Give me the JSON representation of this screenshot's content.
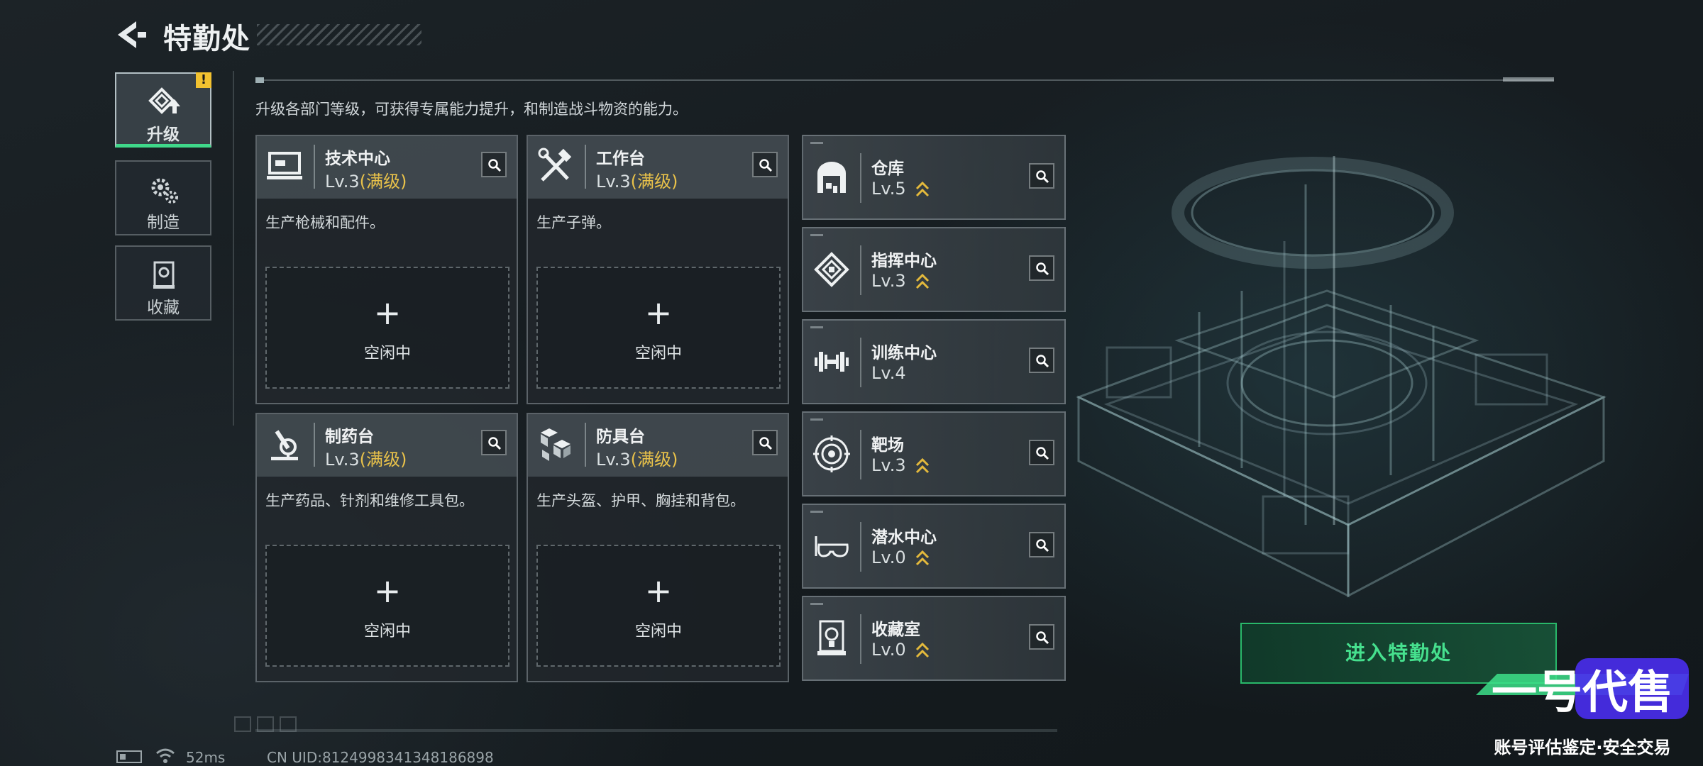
{
  "header": {
    "title": "特勤处"
  },
  "nav": {
    "items": [
      {
        "label": "升级",
        "icon": "upgrade-icon",
        "active": true,
        "alert": "!"
      },
      {
        "label": "制造",
        "icon": "gears-icon",
        "active": false
      },
      {
        "label": "收藏",
        "icon": "collection-icon",
        "active": false
      }
    ]
  },
  "description": "升级各部门等级，可获得专属能力提升，和制造战斗物资的能力。",
  "facilities": [
    {
      "name": "技术中心",
      "level": "Lv.3",
      "max_tag": "(满级)",
      "desc": "生产枪械和配件。",
      "slot_plus": "+",
      "slot_status": "空闲中",
      "icon": "computer-icon"
    },
    {
      "name": "工作台",
      "level": "Lv.3",
      "max_tag": "(满级)",
      "desc": "生产子弹。",
      "slot_plus": "+",
      "slot_status": "空闲中",
      "icon": "tools-icon"
    },
    {
      "name": "制药台",
      "level": "Lv.3",
      "max_tag": "(满级)",
      "desc": "生产药品、针剂和维修工具包。",
      "slot_plus": "+",
      "slot_status": "空闲中",
      "icon": "microscope-icon"
    },
    {
      "name": "防具台",
      "level": "Lv.3",
      "max_tag": "(满级)",
      "desc": "生产头盔、护甲、胸挂和背包。",
      "slot_plus": "+",
      "slot_status": "空闲中",
      "icon": "blocks-icon"
    }
  ],
  "departments": [
    {
      "name": "仓库",
      "level": "Lv.5",
      "upgradable": true,
      "icon": "warehouse-icon"
    },
    {
      "name": "指挥中心",
      "level": "Lv.3",
      "upgradable": true,
      "icon": "chip-icon"
    },
    {
      "name": "训练中心",
      "level": "Lv.4",
      "upgradable": false,
      "icon": "dumbbell-icon"
    },
    {
      "name": "靶场",
      "level": "Lv.3",
      "upgradable": true,
      "icon": "target-icon"
    },
    {
      "name": "潜水中心",
      "level": "Lv.0",
      "upgradable": true,
      "icon": "diving-mask-icon"
    },
    {
      "name": "收藏室",
      "level": "Lv.0",
      "upgradable": true,
      "icon": "display-case-icon"
    }
  ],
  "enter_button": "进入特勤处",
  "status": {
    "ping": "52ms",
    "uid": "CN UID:8124998341348186898"
  },
  "watermark": {
    "logo_text": "一号代售",
    "slogan": "账号评估鉴定·安全交易"
  },
  "colors": {
    "accent_green": "#3fd88a",
    "max_level_gold": "#e9c24a",
    "upgrade_chevron": "#e3b93c",
    "alert_yellow": "#f2c230"
  }
}
